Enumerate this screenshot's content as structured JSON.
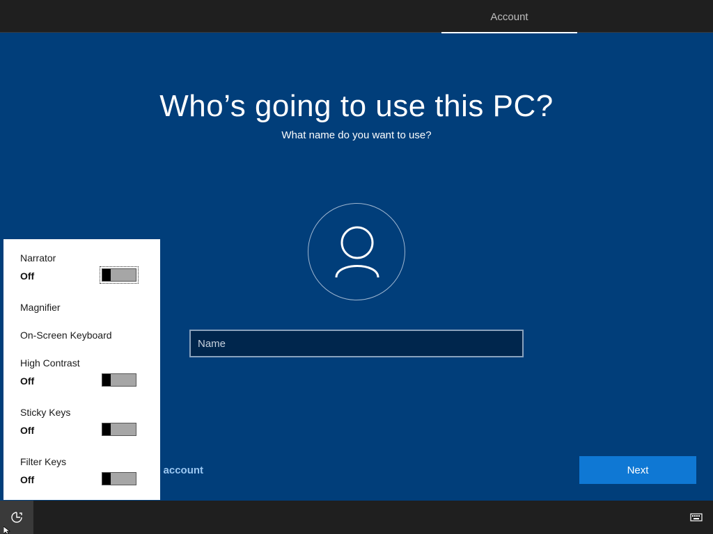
{
  "header": {
    "active_tab": "Account"
  },
  "main": {
    "title": "Who’s going to use this PC?",
    "subtitle": "What name do you want to use?",
    "name_placeholder": "Name",
    "name_value": "",
    "offline_link_label": "e account",
    "next_label": "Next"
  },
  "accessibility": {
    "items": [
      {
        "label": "Narrator",
        "state": "Off",
        "has_toggle": true,
        "focused": true
      },
      {
        "label": "Magnifier",
        "has_toggle": false
      },
      {
        "label": "On-Screen Keyboard",
        "has_toggle": false
      },
      {
        "label": "High Contrast",
        "state": "Off",
        "has_toggle": true
      },
      {
        "label": "Sticky Keys",
        "state": "Off",
        "has_toggle": true
      },
      {
        "label": "Filter Keys",
        "state": "Off",
        "has_toggle": true
      }
    ]
  },
  "taskbar": {
    "left_icon": "ease-of-access-icon",
    "right_icon": "keyboard-icon"
  },
  "colors": {
    "background": "#013e7a",
    "accent": "#0f78d4",
    "bar": "#1f1f1f"
  }
}
